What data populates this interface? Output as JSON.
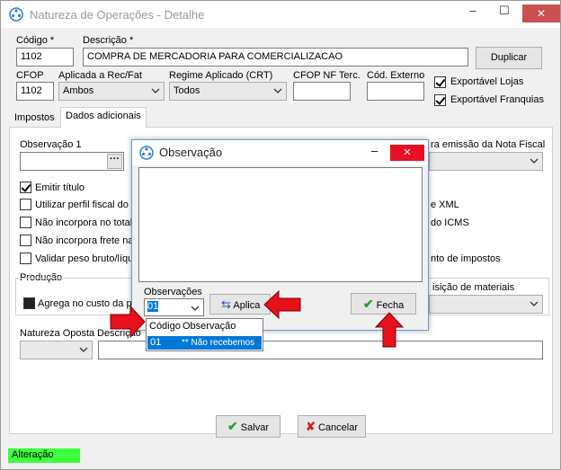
{
  "window": {
    "title": "Natureza de Operações - Detalhe",
    "minimize": "–",
    "maximize": "☐",
    "close": "✕"
  },
  "fields": {
    "codigo_label": "Código *",
    "codigo_value": "1102",
    "descricao_label": "Descrição *",
    "descricao_value": "COMPRA DE MERCADORIA  PARA COMERCIALIZACAO",
    "duplicar": "Duplicar",
    "cfop_label": "CFOP",
    "cfop_value": "1102",
    "aplicada_label": "Aplicada a Rec/Fat",
    "aplicada_value": "Ambos",
    "regime_label": "Regime Aplicado (CRT)",
    "regime_value": "Todos",
    "cfop_nf_label": "CFOP NF Terc.",
    "cod_externo_label": "Cód. Externo",
    "exportavel_lojas": "Exportável Lojas",
    "exportavel_franquias": "Exportável Franquias"
  },
  "tabs": [
    {
      "label": "Impostos"
    },
    {
      "label": "Dados adicionais"
    }
  ],
  "panel": {
    "observacao1_label": "Observação 1",
    "emissao_label": "ra emissão da Nota Fiscal",
    "emitir_titulo": "Emitir título",
    "utilizar_perfil": "Utilizar perfil fiscal do c",
    "nao_incorpora_total": "Não incorpora no total",
    "nao_incorpora_frete": "Não incorpora frete na",
    "validar_peso": "Validar peso bruto/líqu",
    "xml_text": "e XML",
    "icms_text": "do ICMS",
    "impostos_text": "nto de impostos",
    "producao_label": "Produção",
    "agrega_label": "Agrega no custo da p",
    "requisicao_label": "isição de materiais",
    "natureza_oposta_label": "Natureza Oposta",
    "descricao2_label": "Descrição"
  },
  "dialog": {
    "title": "Observação",
    "observacoes_label": "Observações",
    "observacoes_value": "01",
    "aplica": "Aplica",
    "fecha": "Fecha",
    "list_header": [
      "Código",
      "Observação"
    ],
    "list_rows": [
      {
        "codigo": "01",
        "observacao": "** Não recebemos"
      }
    ]
  },
  "footer": {
    "salvar": "Salvar",
    "cancelar": "Cancelar",
    "status": "Alteração"
  },
  "colors": {
    "accent_red": "#e8101a",
    "status_green": "#3dff3d",
    "selection_blue": "#0078d7"
  }
}
